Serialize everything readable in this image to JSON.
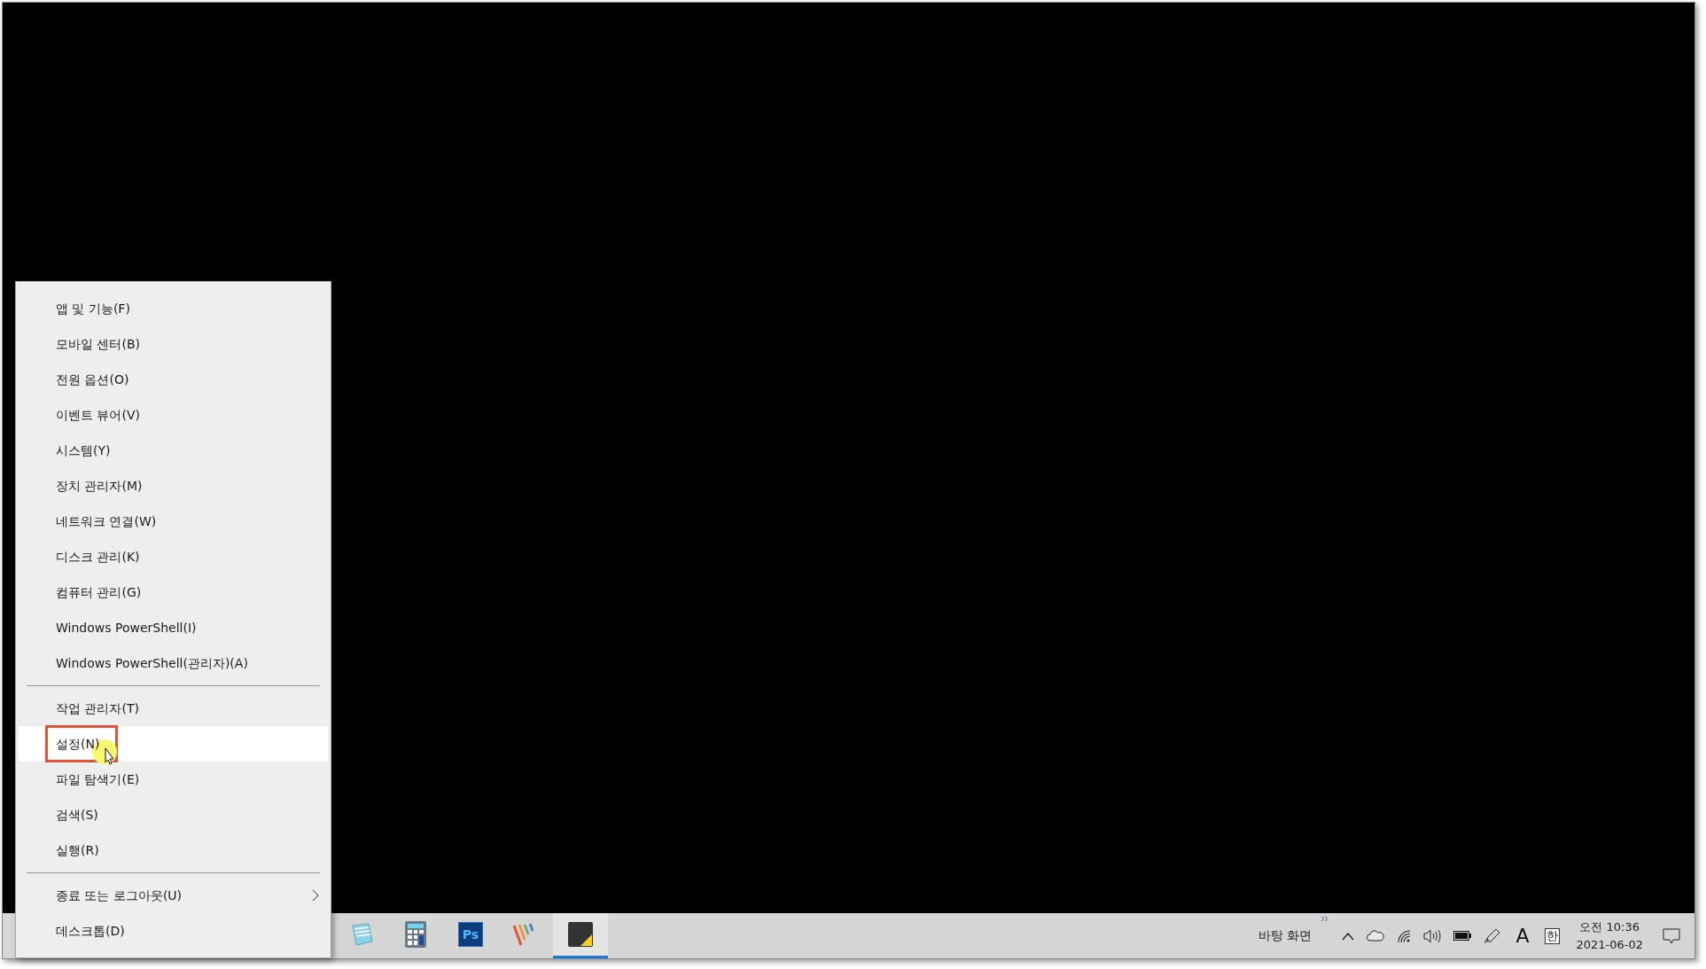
{
  "menu": {
    "items": [
      {
        "kind": "item",
        "label": "앱 및 기능(F)",
        "selected": false
      },
      {
        "kind": "item",
        "label": "모바일 센터(B)",
        "selected": false
      },
      {
        "kind": "item",
        "label": "전원 옵션(O)",
        "selected": false
      },
      {
        "kind": "item",
        "label": "이벤트 뷰어(V)",
        "selected": false
      },
      {
        "kind": "item",
        "label": "시스템(Y)",
        "selected": false
      },
      {
        "kind": "item",
        "label": "장치 관리자(M)",
        "selected": false
      },
      {
        "kind": "item",
        "label": "네트워크 연결(W)",
        "selected": false
      },
      {
        "kind": "item",
        "label": "디스크 관리(K)",
        "selected": false
      },
      {
        "kind": "item",
        "label": "컴퓨터 관리(G)",
        "selected": false
      },
      {
        "kind": "item",
        "label": "Windows PowerShell(I)",
        "selected": false
      },
      {
        "kind": "item",
        "label": "Windows PowerShell(관리자)(A)",
        "selected": false
      },
      {
        "kind": "separator"
      },
      {
        "kind": "item",
        "label": "작업 관리자(T)",
        "selected": false
      },
      {
        "kind": "item",
        "label": "설정(N)",
        "selected": true,
        "highlighted": true
      },
      {
        "kind": "item",
        "label": "파일 탐색기(E)",
        "selected": false
      },
      {
        "kind": "item",
        "label": "검색(S)",
        "selected": false
      },
      {
        "kind": "item",
        "label": "실행(R)",
        "selected": false
      },
      {
        "kind": "separator"
      },
      {
        "kind": "item",
        "label": "종료 또는 로그아웃(U)",
        "selected": false,
        "submenu": true
      },
      {
        "kind": "item",
        "label": "데스크톱(D)",
        "selected": false
      }
    ]
  },
  "taskbar": {
    "apps": [
      {
        "kind": "notepad",
        "active": false
      },
      {
        "kind": "calculator",
        "active": false
      },
      {
        "kind": "photoshop",
        "label": "Ps",
        "active": false
      },
      {
        "kind": "stripes",
        "active": false
      },
      {
        "kind": "sticky",
        "active": true
      }
    ],
    "tray": {
      "desktop_label": "바탕 화면",
      "ime_mode": "A",
      "ime_lang": "한",
      "time": "오전 10:36",
      "date": "2021-06-02"
    }
  }
}
